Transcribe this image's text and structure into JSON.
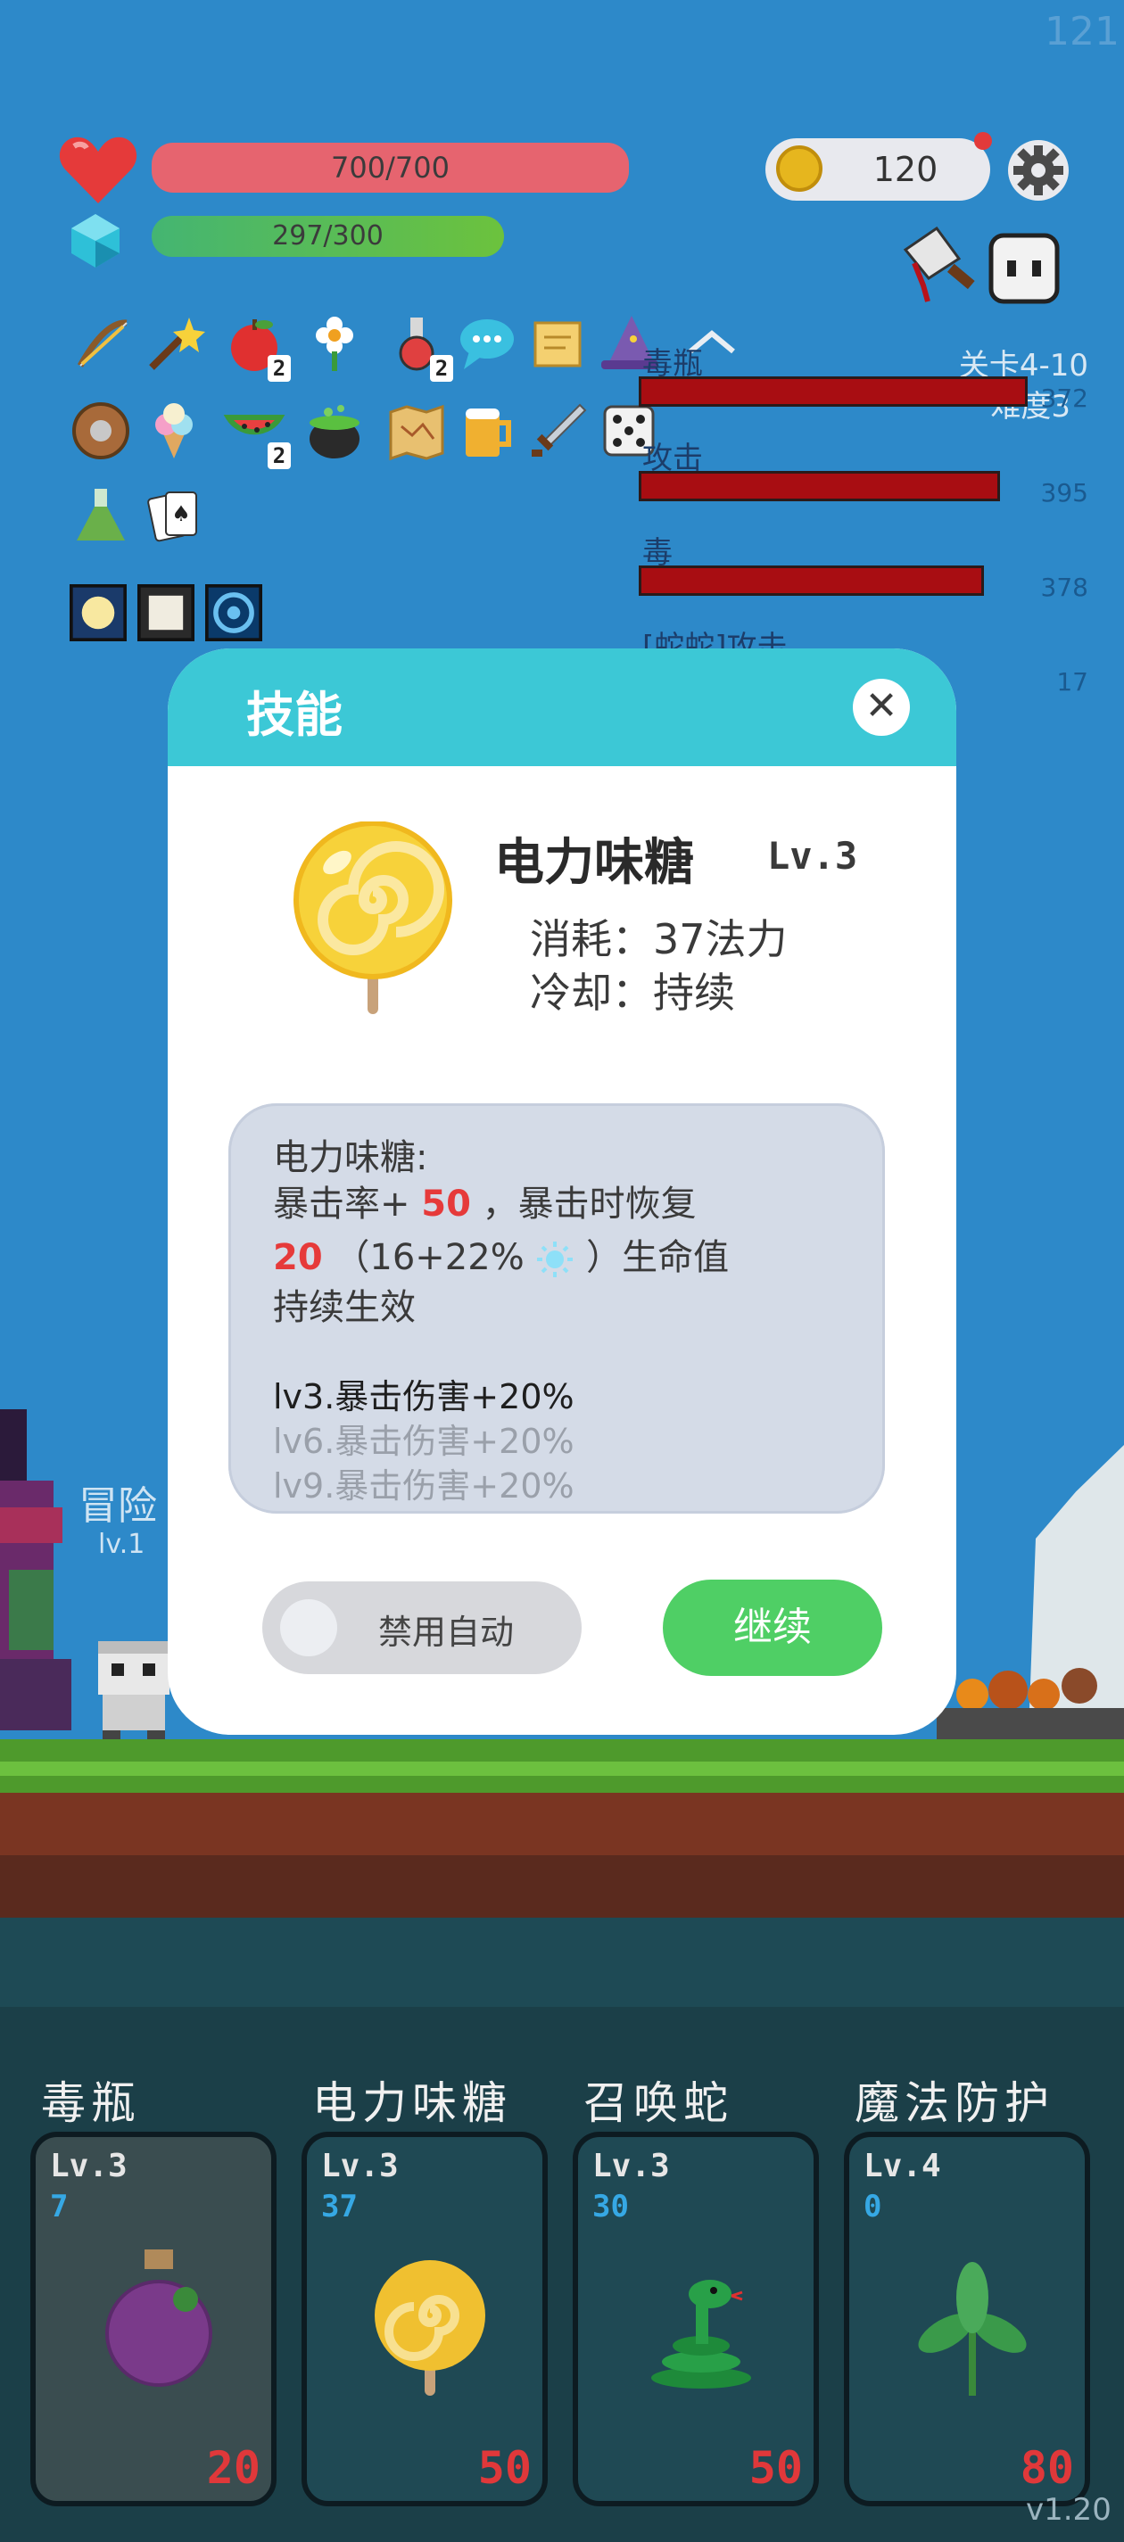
{
  "hud": {
    "fps": "121",
    "hp_text": "700/700",
    "mp_text": "297/300",
    "coins": "120",
    "level_text": "关卡4-10",
    "difficulty_text": "难度3",
    "version": "v1.20"
  },
  "items": {
    "row1": [
      {
        "icon": "bow-icon",
        "count": ""
      },
      {
        "icon": "magic-wand-icon",
        "count": ""
      },
      {
        "icon": "apple-icon",
        "count": "2"
      },
      {
        "icon": "flower-icon",
        "count": ""
      },
      {
        "icon": "potion-icon",
        "count": "2"
      },
      {
        "icon": "speech-bubble-icon",
        "count": ""
      },
      {
        "icon": "scroll-icon",
        "count": ""
      },
      {
        "icon": "wizard-hat-icon",
        "count": ""
      }
    ],
    "row2": [
      {
        "icon": "shield-icon",
        "count": ""
      },
      {
        "icon": "ice-cream-icon",
        "count": ""
      },
      {
        "icon": "watermelon-icon",
        "count": "2"
      },
      {
        "icon": "cauldron-icon",
        "count": ""
      },
      {
        "icon": "map-icon",
        "count": ""
      },
      {
        "icon": "beer-icon",
        "count": ""
      },
      {
        "icon": "sword-icon",
        "count": ""
      },
      {
        "icon": "dice-icon",
        "count": ""
      }
    ],
    "row3": [
      {
        "icon": "flask-icon",
        "count": ""
      },
      {
        "icon": "cards-icon",
        "count": ""
      }
    ],
    "runes": [
      {
        "icon": "rune-yellow-icon"
      },
      {
        "icon": "rune-white-icon"
      },
      {
        "icon": "rune-blue-icon"
      }
    ]
  },
  "damage_stats": [
    {
      "label": "毒瓶",
      "value": "372",
      "fill": 0.99
    },
    {
      "label": "攻击",
      "value": "395",
      "fill": 0.92
    },
    {
      "label": "毒",
      "value": "378",
      "fill": 0.88
    },
    {
      "label": "[蛇蛇]攻击",
      "value": "17",
      "fill": 0.05
    }
  ],
  "dialog": {
    "title": "技能",
    "close": "✕",
    "skill_name": "电力味糖",
    "skill_level": "Lv.3",
    "cost": "消耗：37法力",
    "cooldown": "冷却：持续",
    "desc_title": "电力味糖:",
    "desc_crit_prefix": "暴击率+",
    "desc_crit_value": "50",
    "desc_crit_suffix": "，暴击时恢复",
    "desc_heal_value": "20",
    "desc_heal_formula_open": "（16+22%",
    "desc_heal_formula_close": "）生命值",
    "desc_duration": "持续生效",
    "upgrades": [
      "lv3.暴击伤害+20%",
      "lv6.暴击伤害+20%",
      "lv9.暴击伤害+20%"
    ],
    "toggle_label": "禁用自动",
    "toggle_on": false,
    "continue": "继续"
  },
  "skill_cards": [
    {
      "title": "毒瓶",
      "level": "Lv.3",
      "cost": "7",
      "number": "20",
      "icon": "poison-bottle-icon"
    },
    {
      "title": "电力味糖",
      "level": "Lv.3",
      "cost": "37",
      "number": "50",
      "icon": "lollipop-icon"
    },
    {
      "title": "召唤蛇",
      "level": "Lv.3",
      "cost": "30",
      "number": "50",
      "icon": "snake-icon"
    },
    {
      "title": "魔法防护",
      "level": "Lv.4",
      "cost": "0",
      "number": "80",
      "icon": "leaf-icon"
    }
  ],
  "scene": {
    "adventurer_label": "冒险",
    "adventurer_level": "lv.1"
  },
  "colors": {
    "accent_header": "#3cc8d6",
    "continue_green": "#4fcf65",
    "damage_red": "#a80d12",
    "value_red": "#e63a3a"
  }
}
